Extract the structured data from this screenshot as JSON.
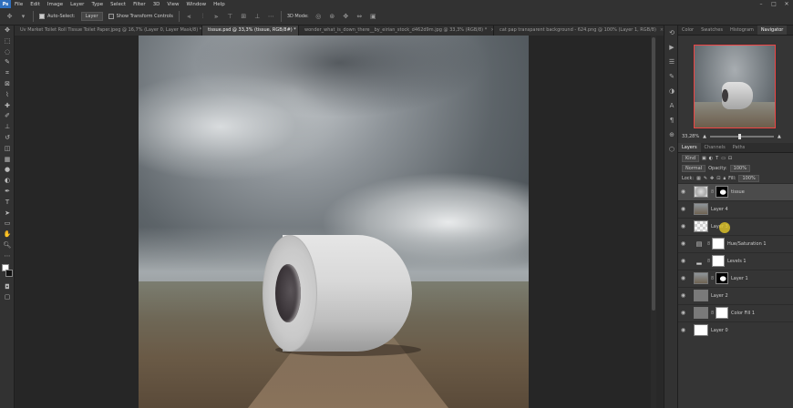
{
  "menubar": {
    "logo": "Ps",
    "items": [
      "File",
      "Edit",
      "Image",
      "Layer",
      "Type",
      "Select",
      "Filter",
      "3D",
      "View",
      "Window",
      "Help"
    ],
    "window_controls": [
      "–",
      "□",
      "✕"
    ]
  },
  "options": {
    "auto_select_label": "Auto-Select:",
    "auto_select_mode": "Layer",
    "transform_label": "Show Transform Controls",
    "mode_3d": "3D Mode:"
  },
  "tabs": [
    {
      "label": "Uv Market Toilet Roll Tissue Toilet Paper.jpeg @ 16,7% (Layer 0, Layer Mask/8) *",
      "active": false
    },
    {
      "label": "tissue.psd @ 33,3% (tissue, RGB/8#) *",
      "active": true
    },
    {
      "label": "wonder_what_is_down_there__by_eirian_stock_d462d9m.jpg @ 33,3% (RGB/8) *",
      "active": false
    },
    {
      "label": "cat pap transparent background - 624.png @ 100% (Layer 1, RGB/8)",
      "active": false
    }
  ],
  "navigator": {
    "tabs": [
      "Color",
      "Swatches",
      "Histogram",
      "Navigator"
    ],
    "active_tab": "Navigator",
    "zoom": "33,28%",
    "zoom_fraction": 0.45
  },
  "layers_panel": {
    "tabs": [
      "Layers",
      "Channels",
      "Paths"
    ],
    "kind_label": "Kind",
    "blend_mode": "Normal",
    "opacity_label": "Opacity:",
    "opacity_value": "100%",
    "lock_label": "Lock:",
    "fill_label": "Fill:",
    "fill_value": "100%",
    "layers": [
      {
        "name": "tissue",
        "selected": true,
        "thumb": "tissue",
        "mask": "black-white",
        "adjustment": ""
      },
      {
        "name": "Layer 4",
        "selected": false,
        "thumb": "photo",
        "mask": "",
        "adjustment": ""
      },
      {
        "name": "Layer 3",
        "selected": false,
        "thumb": "checker",
        "mask": "",
        "adjustment": ""
      },
      {
        "name": "Hue/Saturation 1",
        "selected": false,
        "thumb": "",
        "mask": "white",
        "adjustment": "▤"
      },
      {
        "name": "Levels 1",
        "selected": false,
        "thumb": "",
        "mask": "white",
        "adjustment": "▂"
      },
      {
        "name": "Layer 1",
        "selected": false,
        "thumb": "photo",
        "mask": "black-white",
        "adjustment": ""
      },
      {
        "name": "Layer 2",
        "selected": false,
        "thumb": "grey",
        "mask": "",
        "adjustment": ""
      },
      {
        "name": "Color Fill 1",
        "selected": false,
        "thumb": "grey",
        "mask": "white",
        "adjustment": ""
      },
      {
        "name": "Layer 0",
        "selected": false,
        "thumb": "white",
        "mask": "",
        "adjustment": ""
      }
    ]
  },
  "colors": {
    "accent": "#2f6fbd",
    "navigator_frame": "#ee4444",
    "cursor": "#e4c828"
  }
}
